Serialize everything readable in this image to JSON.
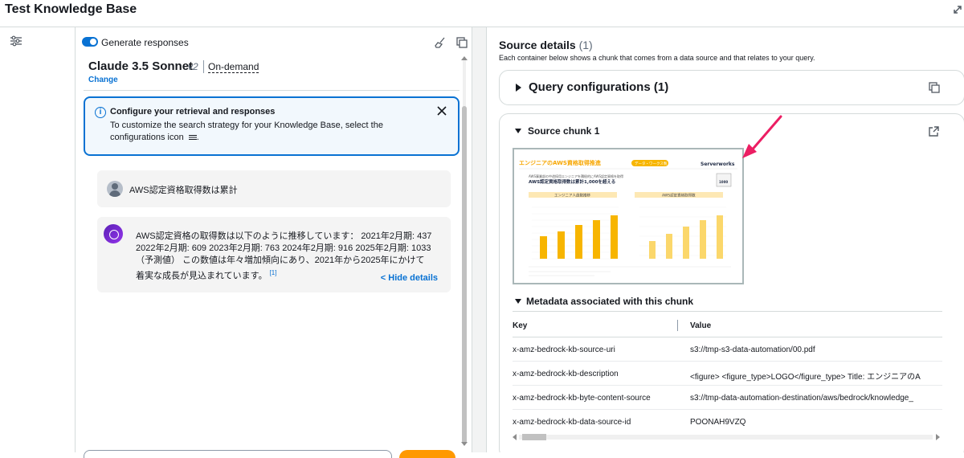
{
  "app": {
    "title": "Test Knowledge Base"
  },
  "chat": {
    "toggle_label": "Generate responses",
    "model": {
      "name": "Claude 3.5 Sonnet",
      "version": "v2",
      "mode": "On-demand",
      "change_label": "Change"
    },
    "info": {
      "title": "Configure your retrieval and responses",
      "body_before_icon": "To customize the search strategy for your Knowledge Base, select the configurations icon",
      "body_after_icon": "."
    },
    "user_message": "AWS認定資格取得数は累計",
    "bot_message": "AWS認定資格の取得数は以下のように推移しています： 2021年2月期: 437 2022年2月期: 609 2023年2月期: 763 2024年2月期: 916 2025年2月期: 1033（予測値） この数値は年々増加傾向にあり、2021年から2025年にかけて着実な成長が見込まれています。",
    "citation": "[1]",
    "hide_details_label": "< Hide details"
  },
  "source": {
    "title": "Source details",
    "count": "(1)",
    "description": "Each container below shows a chunk that comes from a data source and that relates to your query.",
    "query_config_label": "Query configurations (1)",
    "chunk_title": "Source chunk 1",
    "thumbnail": {
      "title": "エンジニアのAWS資格取得推進",
      "tag": "データ・ワークス製",
      "brand": "Serverworks",
      "subtitle1": "AWS事業部の中途採用エンジニアを積極的にAWS認定資格を取得",
      "subtitle2": "AWS認定資格取得数は累計1,000を超える",
      "badge": "1000",
      "left_chart_title": "エンジニア人員数推移",
      "right_chart_title": "AWS認定資格取得数"
    },
    "metadata_title": "Metadata associated with this chunk",
    "table": {
      "key_header": "Key",
      "value_header": "Value",
      "rows": [
        {
          "key": "x-amz-bedrock-kb-source-uri",
          "value": "s3://tmp-s3-data-automation/00.pdf"
        },
        {
          "key": "x-amz-bedrock-kb-description",
          "value": "<figure> <figure_type>LOGO</figure_type> Title: エンジニアのA"
        },
        {
          "key": "x-amz-bedrock-kb-byte-content-source",
          "value": "s3://tmp-data-automation-destination/aws/bedrock/knowledge_"
        },
        {
          "key": "x-amz-bedrock-kb-data-source-id",
          "value": "POONAH9VZQ"
        }
      ]
    }
  },
  "colors": {
    "accent": "#0972d3",
    "run_button": "#ff9900",
    "arrow": "#ec1e63",
    "chart_bar": "#f7b500"
  }
}
